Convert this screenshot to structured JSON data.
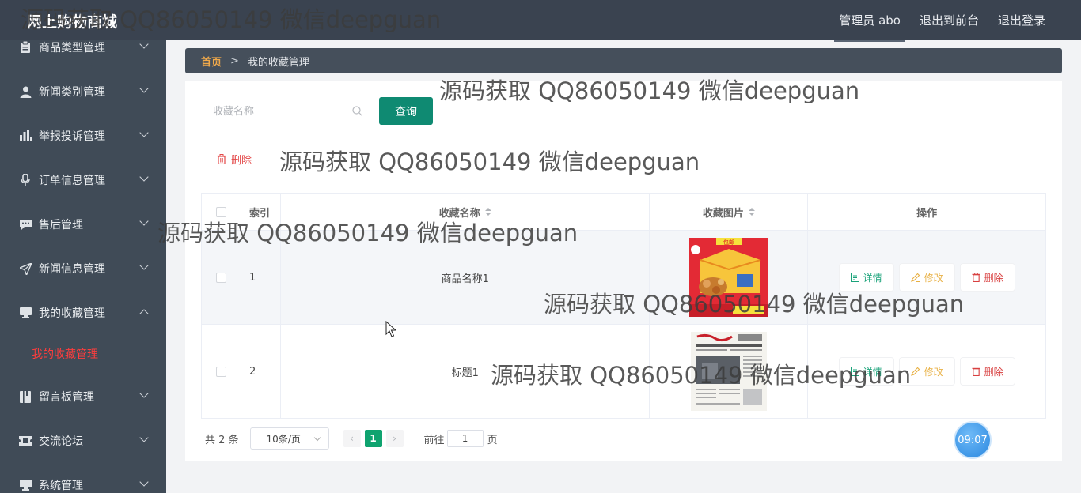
{
  "app": {
    "title": "网上购物商城"
  },
  "header": {
    "admin_label": "管理员 abo",
    "front_link": "退出到前台",
    "logout_link": "退出登录"
  },
  "sidebar": {
    "items": [
      {
        "label": "商品类型管理",
        "icon": "clipboard-icon"
      },
      {
        "label": "新闻类别管理",
        "icon": "user-icon"
      },
      {
        "label": "举报投诉管理",
        "icon": "bar-chart-icon"
      },
      {
        "label": "订单信息管理",
        "icon": "microphone-icon"
      },
      {
        "label": "售后管理",
        "icon": "chat-bubble-icon"
      },
      {
        "label": "新闻信息管理",
        "icon": "send-icon"
      },
      {
        "label": "我的收藏管理",
        "icon": "monitor-icon",
        "expanded": true
      },
      {
        "label": "留言板管理",
        "icon": "book-icon"
      },
      {
        "label": "交流论坛",
        "icon": "ticket-icon"
      },
      {
        "label": "系统管理",
        "icon": "monitor-icon"
      }
    ],
    "active_sub": "我的收藏管理"
  },
  "breadcrumb": {
    "home": "首页",
    "separator": ">",
    "current": "我的收藏管理"
  },
  "search": {
    "placeholder": "收藏名称",
    "value": "",
    "button_label": "查询"
  },
  "toolbar": {
    "delete_label": "删除"
  },
  "table": {
    "columns": [
      "索引",
      "收藏名称",
      "收藏图片",
      "操作"
    ],
    "rows": [
      {
        "index": "1",
        "name": "商品名称1",
        "image": "snack-box-image"
      },
      {
        "index": "2",
        "name": "标题1",
        "image": "newspaper-image"
      }
    ],
    "actions": {
      "detail": "详情",
      "edit": "修改",
      "delete": "删除"
    }
  },
  "pagination": {
    "total_text": "共 2 条",
    "page_size": "10条/页",
    "current_page": "1",
    "goto_prefix": "前往",
    "goto_value": "1",
    "goto_suffix": "页"
  },
  "clock": {
    "time": "09:07"
  },
  "watermark": "源码获取 QQ86050149 微信deepguan",
  "colors": {
    "topbar": "#3a4350",
    "sidebar": "#404b57",
    "primary": "#0f8a72",
    "active_sub": "#ff3d3d",
    "breadcrumb_home": "#f0a94b"
  }
}
